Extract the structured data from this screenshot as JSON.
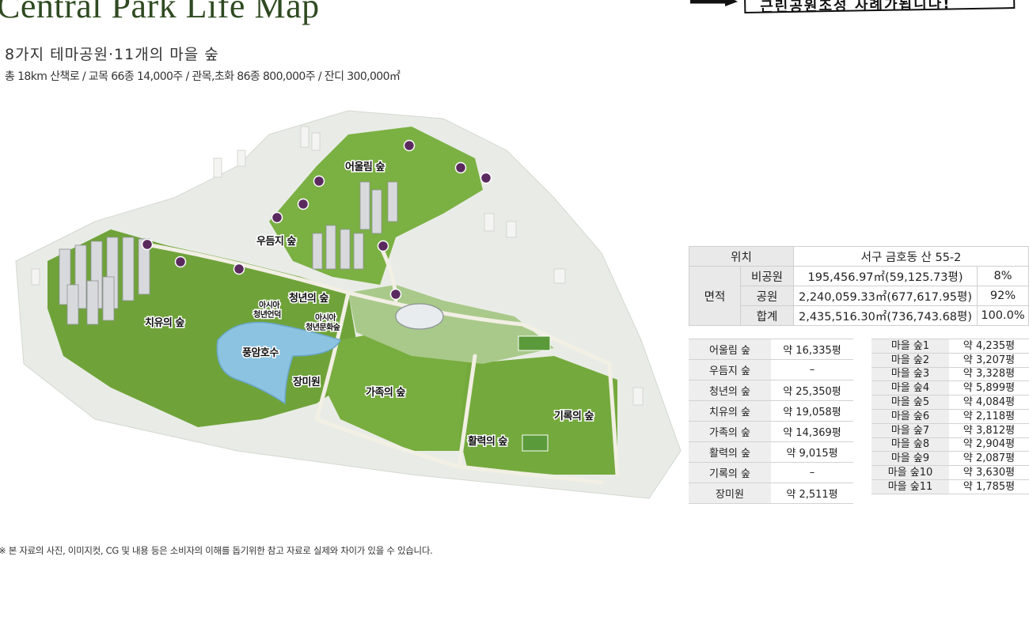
{
  "header": {
    "title": "Central Park Life Map",
    "subtitle": "8가지 테마공원·11개의 마을 숲",
    "stats": "총 18km 산책로 / 교목 66종 14,000주 / 관목,초화 86종 800,000주 / 잔디 300,000㎡"
  },
  "banner": {
    "text": "근린공원조성 사례가됩니다!"
  },
  "map": {
    "labels": {
      "eoulim": "어울림 숲",
      "udeumji": "우듬지 숲",
      "cheongnyeon": "청년의 숲",
      "asia_eondeok_1": "아시아",
      "asia_eondeok_2": "청년언덕",
      "asia_munhwa_1": "아시아",
      "asia_munhwa_2": "청년문화숲",
      "chiyu": "치유의 숲",
      "lake": "풍암호수",
      "rose": "장미원",
      "family": "가족의 숲",
      "hwallyeok": "활력의 숲",
      "girok": "기록의 숲"
    },
    "colors": {
      "marker": "#5a2a5e",
      "park": "#6fa03a",
      "lake": "#8cc3e0"
    }
  },
  "location_table": {
    "location_label": "위치",
    "location_value": "서구 금호동 산 55-2",
    "area_label": "면적",
    "rows": [
      {
        "type": "비공원",
        "area": "195,456.97㎡(59,125.73평)",
        "ratio": "8%"
      },
      {
        "type": "공원",
        "area": "2,240,059.33㎡(677,617.95평)",
        "ratio": "92%"
      },
      {
        "type": "합계",
        "area": "2,435,516.30㎡(736,743.68평)",
        "ratio": "100.0%"
      }
    ]
  },
  "zone_table": [
    {
      "name": "어울림 숲",
      "area": "약 16,335평"
    },
    {
      "name": "우듬지 숲",
      "area": "–"
    },
    {
      "name": "청년의 숲",
      "area": "약 25,350평"
    },
    {
      "name": "치유의 숲",
      "area": "약 19,058평"
    },
    {
      "name": "가족의 숲",
      "area": "약 14,369평"
    },
    {
      "name": "활력의 숲",
      "area": "약 9,015평"
    },
    {
      "name": "기록의 숲",
      "area": "–"
    },
    {
      "name": "장미원",
      "area": "약 2,511평"
    }
  ],
  "village_table": [
    {
      "name": "마을 숲1",
      "area": "약 4,235평"
    },
    {
      "name": "마을 숲2",
      "area": "약 3,207평"
    },
    {
      "name": "마을 숲3",
      "area": "약 3,328평"
    },
    {
      "name": "마을 숲4",
      "area": "약 5,899평"
    },
    {
      "name": "마을 숲5",
      "area": "약 4,084평"
    },
    {
      "name": "마을 숲6",
      "area": "약 2,118평"
    },
    {
      "name": "마을 숲7",
      "area": "약 3,812평"
    },
    {
      "name": "마을 숲8",
      "area": "약 2,904평"
    },
    {
      "name": "마을 숲9",
      "area": "약 2,087평"
    },
    {
      "name": "마을 숲10",
      "area": "약 3,630평"
    },
    {
      "name": "마을 숲11",
      "area": "약 1,785평"
    }
  ],
  "footer": {
    "disclaimer": "※ 본 자료의 사진, 이미지컷, CG 및 내용 등은 소비자의 이해를 돕기위한 참고 자료로 실제와 차이가 있을 수 있습니다."
  }
}
